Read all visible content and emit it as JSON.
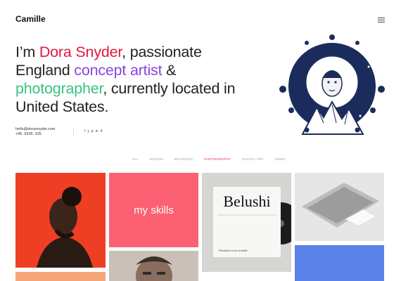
{
  "brand": {
    "logo": "Camille"
  },
  "hero": {
    "p1": "I’m ",
    "name": "Dora Snyder",
    "p2": ", passionate England ",
    "role1": "concept artist",
    "p3": "  & ",
    "role2": "photographer",
    "p4": ", currently located in United States."
  },
  "contact": {
    "email": "hello@dorasnyder.com",
    "phone": "+45. 5535. 325"
  },
  "social": [
    "f",
    "y",
    "p",
    "in",
    "d"
  ],
  "filters": {
    "active": "PHOTOGRAPHY",
    "items": [
      "ALL",
      "DESIGN",
      "BRANDING",
      "PHOTOGRAPHY",
      "DIGITAL ART",
      "VIDEO"
    ]
  },
  "portfolio": {
    "skills_label": "my skills",
    "album_title": "Belushi",
    "album_subtitle": "Disturbios en la sociedad"
  },
  "colors": {
    "name": "#e5173f",
    "concept": "#8a44e6",
    "photographer": "#3ac27d",
    "tile_red": "#ee3f25",
    "tile_pink": "#fb6172",
    "tile_blue": "#5a82e8"
  },
  "icons": {
    "menu": "hamburger-menu-icon",
    "art": "astronaut-moon-illustration"
  }
}
